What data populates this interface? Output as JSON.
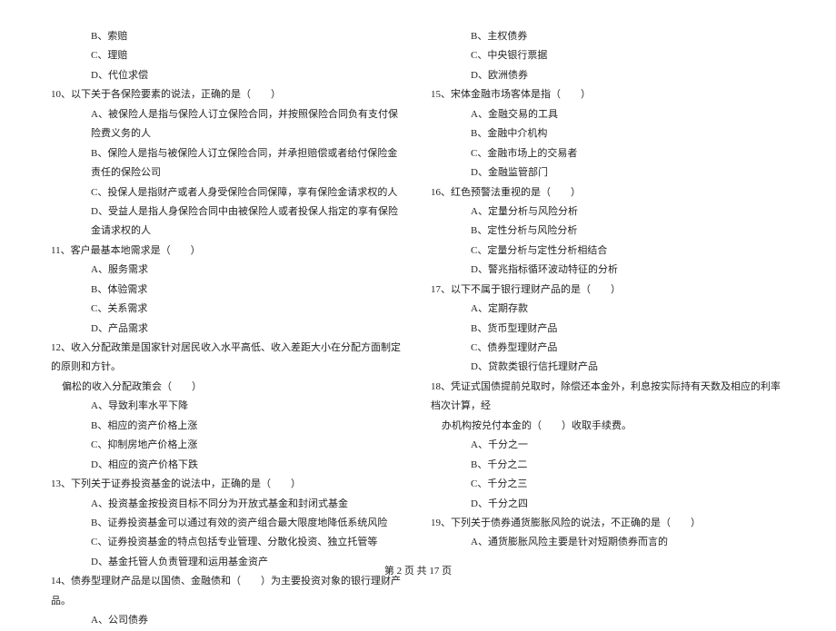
{
  "left": {
    "pre_opts": [
      "B、索赔",
      "C、理赔",
      "D、代位求偿"
    ],
    "q10": "10、以下关于各保险要素的说法，正确的是（　　）",
    "q10_opts": [
      "A、被保险人是指与保险人订立保险合同，并按照保险合同负有支付保险费义务的人",
      "B、保险人是指与被保险人订立保险合同，并承担赔偿或者给付保险金责任的保险公司",
      "C、投保人是指财产或者人身受保险合同保障，享有保险金请求权的人",
      "D、受益人是指人身保险合同中由被保险人或者投保人指定的享有保险金请求权的人"
    ],
    "q11": "11、客户最基本地需求是（　　）",
    "q11_opts": [
      "A、服务需求",
      "B、体验需求",
      "C、关系需求",
      "D、产品需求"
    ],
    "q12a": "12、收入分配政策是国家针对居民收入水平高低、收入差距大小在分配方面制定的原则和方针。",
    "q12b": "偏松的收入分配政策会（　　）",
    "q12_opts": [
      "A、导致利率水平下降",
      "B、相应的资产价格上涨",
      "C、抑制房地产价格上涨",
      "D、相应的资产价格下跌"
    ],
    "q13": "13、下列关于证券投资基金的说法中，正确的是（　　）",
    "q13_opts": [
      "A、投资基金按投资目标不同分为开放式基金和封闭式基金",
      "B、证券投资基金可以通过有效的资产组合最大限度地降低系统风险",
      "C、证券投资基金的特点包括专业管理、分散化投资、独立托管等",
      "D、基金托管人负责管理和运用基金资产"
    ],
    "q14": "14、债券型理财产品是以国债、金融债和（　　）为主要投资对象的银行理财产品。",
    "q14_optA": "A、公司债券"
  },
  "right": {
    "pre_opts": [
      "B、主权债券",
      "C、中央银行票据",
      "D、欧洲债券"
    ],
    "q15": "15、宋体金融市场客体是指（　　）",
    "q15_opts": [
      "A、金融交易的工具",
      "B、金融中介机构",
      "C、金融市场上的交易者",
      "D、金融监管部门"
    ],
    "q16": "16、红色预警法重视的是（　　）",
    "q16_opts": [
      "A、定量分析与风险分析",
      "B、定性分析与风险分析",
      "C、定量分析与定性分析相结合",
      "D、警兆指标循环波动特征的分析"
    ],
    "q17": "17、以下不属于银行理财产品的是（　　）",
    "q17_opts": [
      "A、定期存款",
      "B、货币型理财产品",
      "C、债券型理财产品",
      "D、贷款类银行信托理财产品"
    ],
    "q18a": "18、凭证式国债提前兑取时，除偿还本金外，利息按实际持有天数及相应的利率档次计算，经",
    "q18b": "办机构按兑付本金的（　　）收取手续费。",
    "q18_opts": [
      "A、千分之一",
      "B、千分之二",
      "C、千分之三",
      "D、千分之四"
    ],
    "q19": "19、下列关于债券通货膨胀风险的说法，不正确的是（　　）",
    "q19_optA": "A、通货膨胀风险主要是针对短期债券而言的"
  },
  "footer": "第 2 页 共 17 页"
}
